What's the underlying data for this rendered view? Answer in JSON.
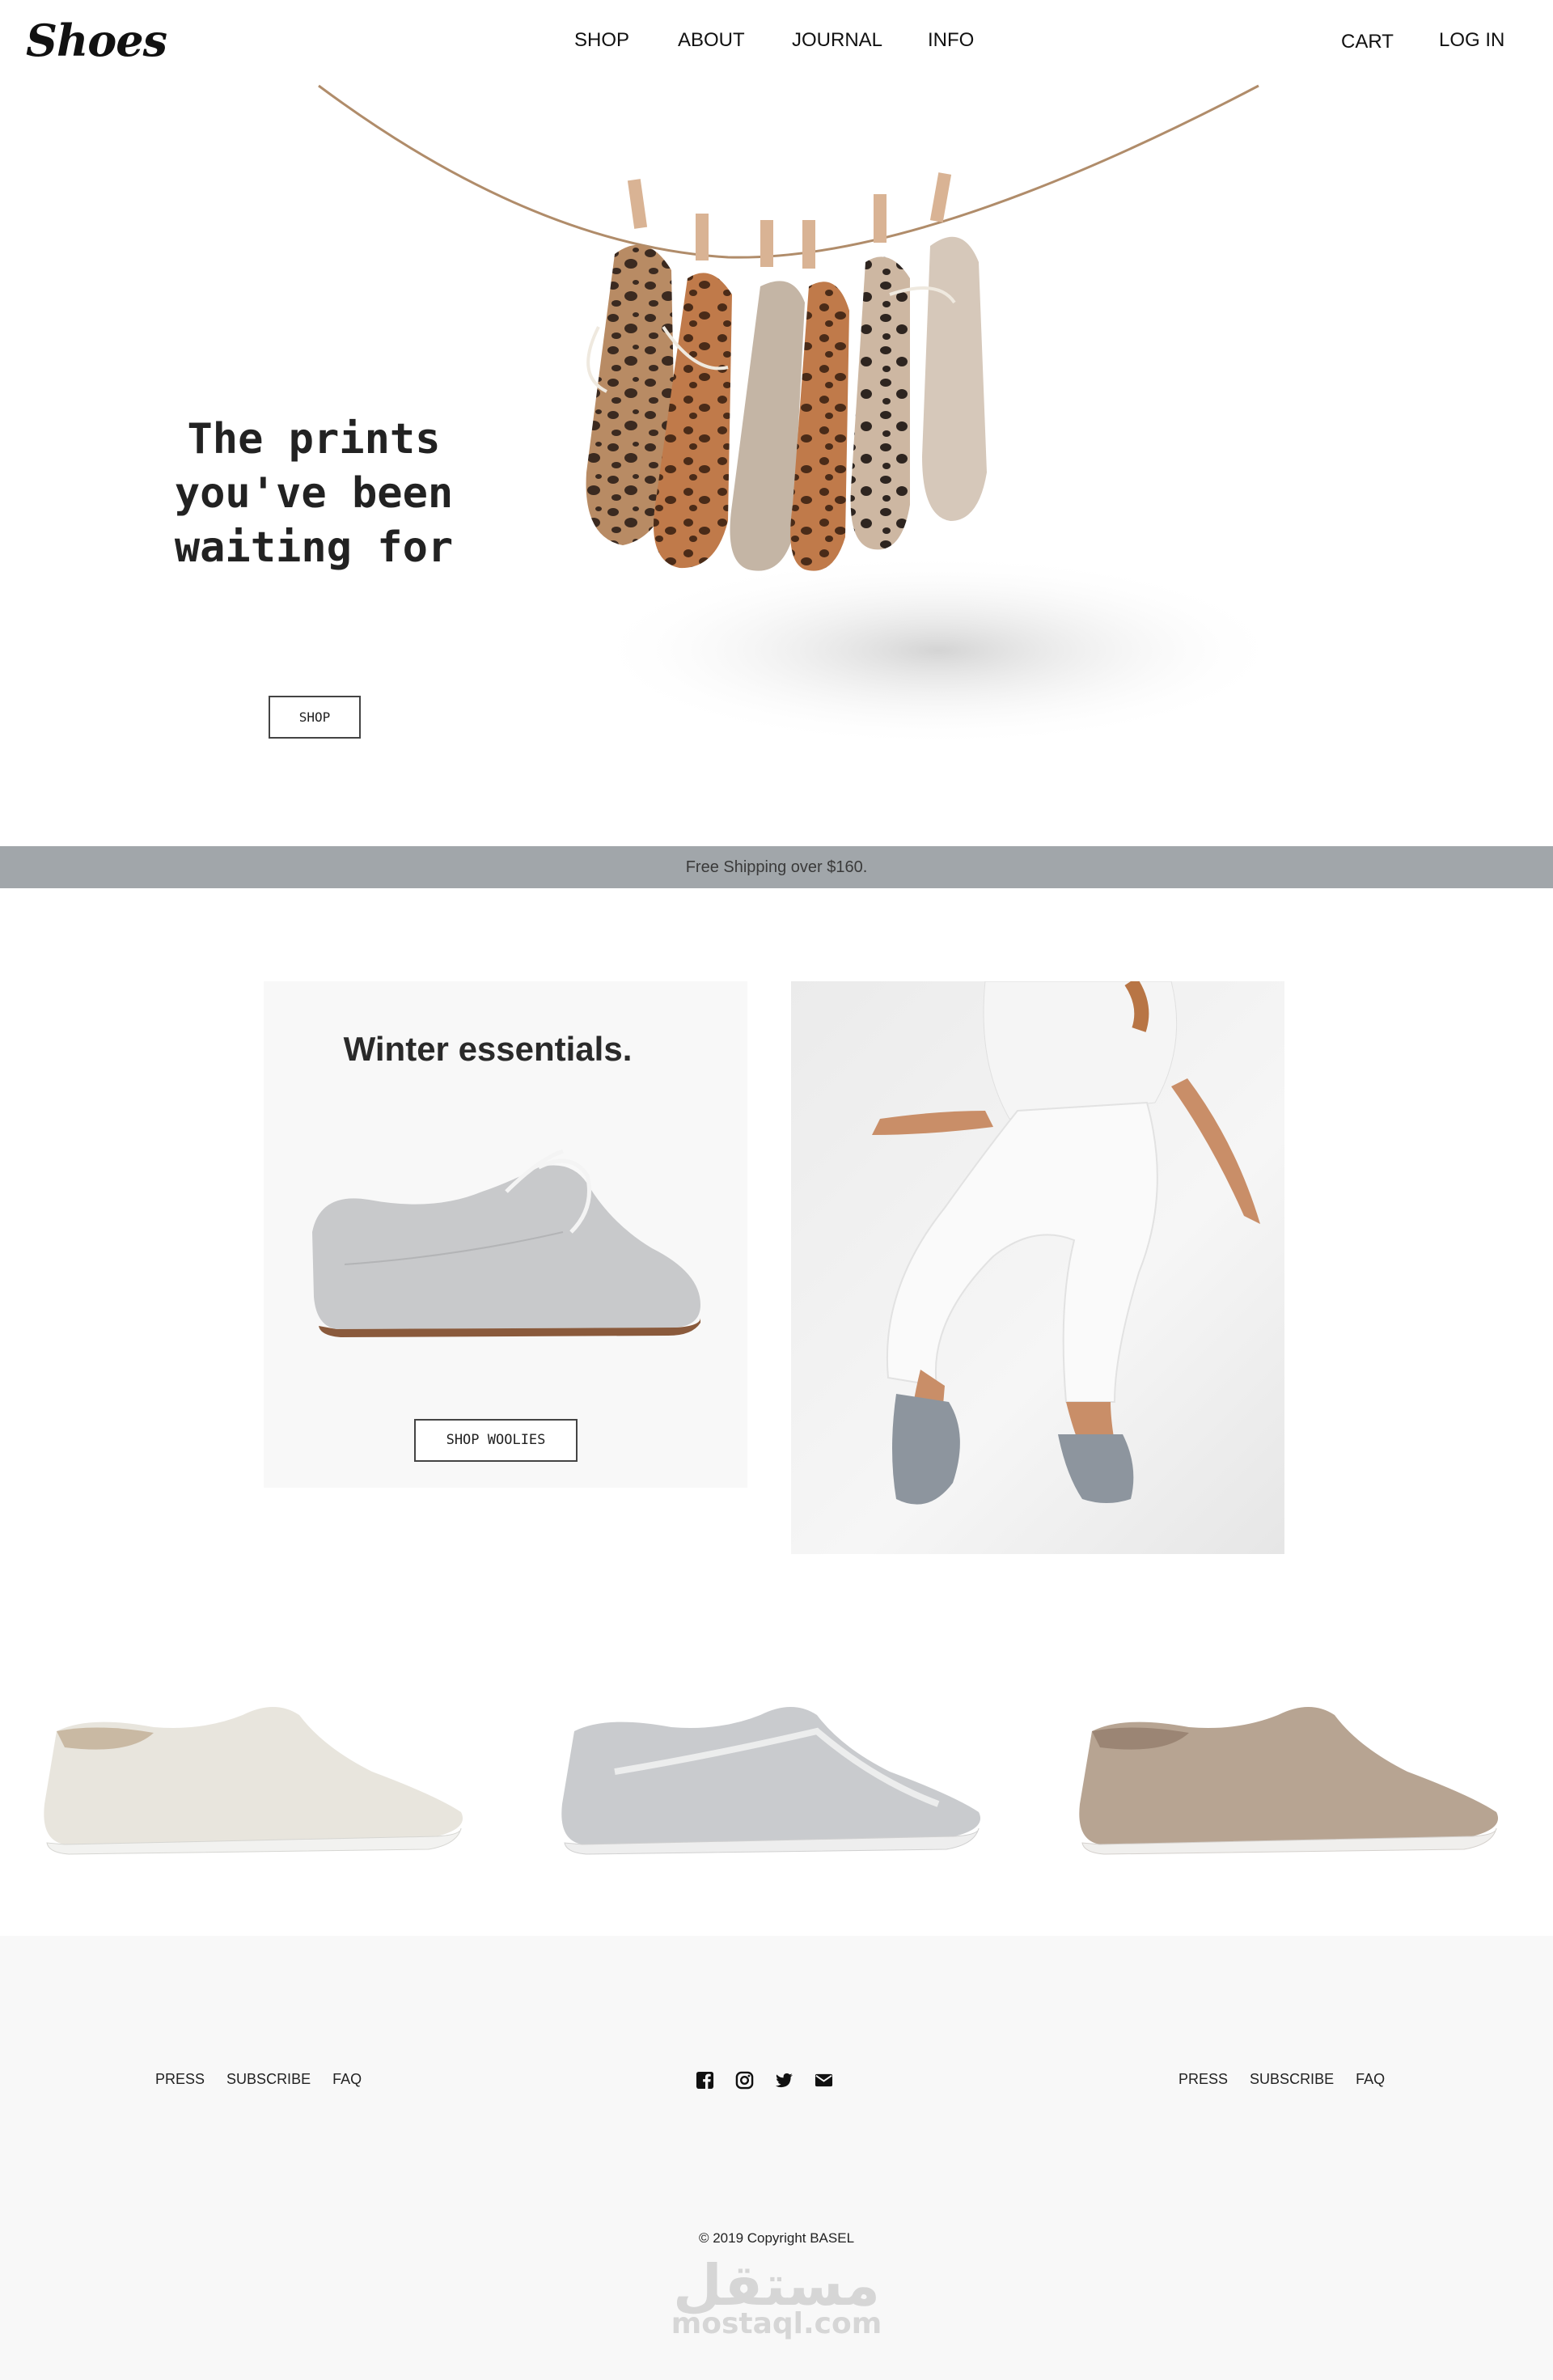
{
  "header": {
    "logo": "Shoes",
    "nav": [
      "SHOP",
      "ABOUT",
      "JOURNAL",
      "INFO"
    ],
    "cart": "CART",
    "login": "LOG IN"
  },
  "hero": {
    "title": "The prints you've been waiting for",
    "button": "SHOP"
  },
  "banner": {
    "text": "Free Shipping over $160."
  },
  "winter": {
    "title": "Winter essentials.",
    "button": "SHOP WOOLIES"
  },
  "footer": {
    "links_left": [
      "PRESS",
      "SUBSCRIBE",
      "FAQ"
    ],
    "links_right": [
      "PRESS",
      "SUBSCRIBE",
      "FAQ"
    ],
    "social_icons": [
      "facebook-icon",
      "instagram-icon",
      "twitter-icon",
      "email-icon"
    ],
    "copyright": "© 2019 Copyright BASEL",
    "watermark_ar": "مستقل",
    "watermark_en": "mostaql.com"
  },
  "colors": {
    "banner_bg": "#a1a6aa",
    "footer_bg": "#f8f8f8",
    "card_bg": "#f8f8f8"
  }
}
